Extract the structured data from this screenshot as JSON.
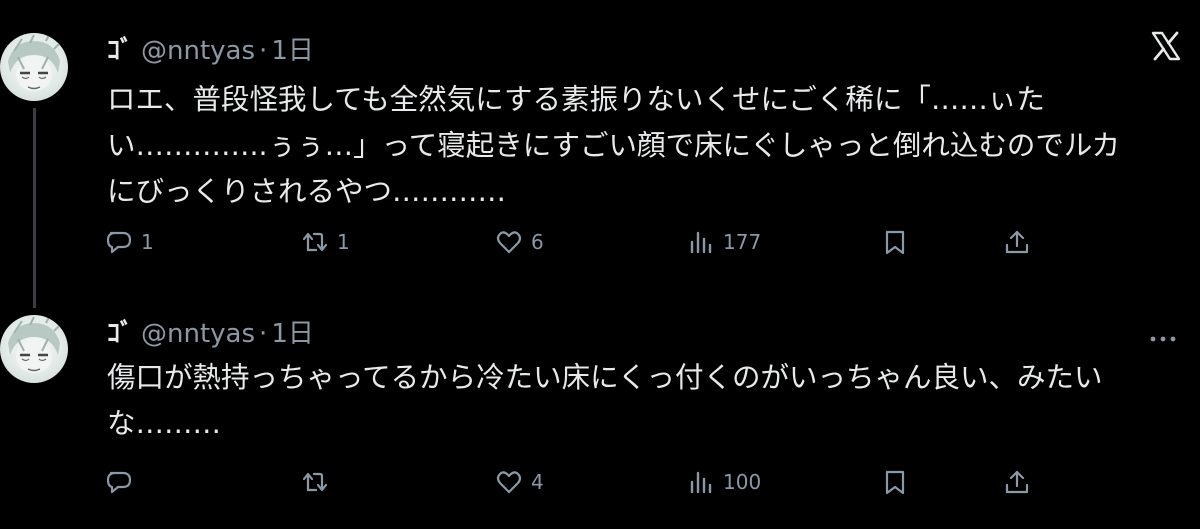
{
  "colors": {
    "background": "#000000",
    "text": "#e7e9ea",
    "muted": "#8b98a5",
    "thread_line": "#3b3f44"
  },
  "tweets": [
    {
      "display_name": "ｺﾞ",
      "handle": "@nntyas",
      "dot": "·",
      "time": "1日",
      "text": "ロエ、普段怪我しても全然気にする素振りないくせにごく稀に「……ぃた\nい…………..ぅぅ…」って寝起きにすごい顔で床にぐしゃっと倒れ込むのでルカ\nにびっくりされるやつ…………",
      "actions": {
        "reply_icon": "reply-icon",
        "reply_count": "1",
        "retweet_icon": "retweet-icon",
        "retweet_count": "1",
        "like_icon": "heart-icon",
        "like_count": "6",
        "views_icon": "views-icon",
        "views_count": "177",
        "bookmark_icon": "bookmark-icon",
        "share_icon": "share-icon"
      },
      "corner_icon": "x-logo-icon"
    },
    {
      "display_name": "ｺﾞ",
      "handle": "@nntyas",
      "dot": "·",
      "time": "1日",
      "text": "傷口が熱持っちゃってるから冷たい床にくっ付くのがいっちゃん良い、みたい\nな………",
      "actions": {
        "reply_icon": "reply-icon",
        "reply_count": "",
        "retweet_icon": "retweet-icon",
        "retweet_count": "",
        "like_icon": "heart-icon",
        "like_count": "4",
        "views_icon": "views-icon",
        "views_count": "100",
        "bookmark_icon": "bookmark-icon",
        "share_icon": "share-icon"
      },
      "corner_icon": "more-icon"
    }
  ]
}
